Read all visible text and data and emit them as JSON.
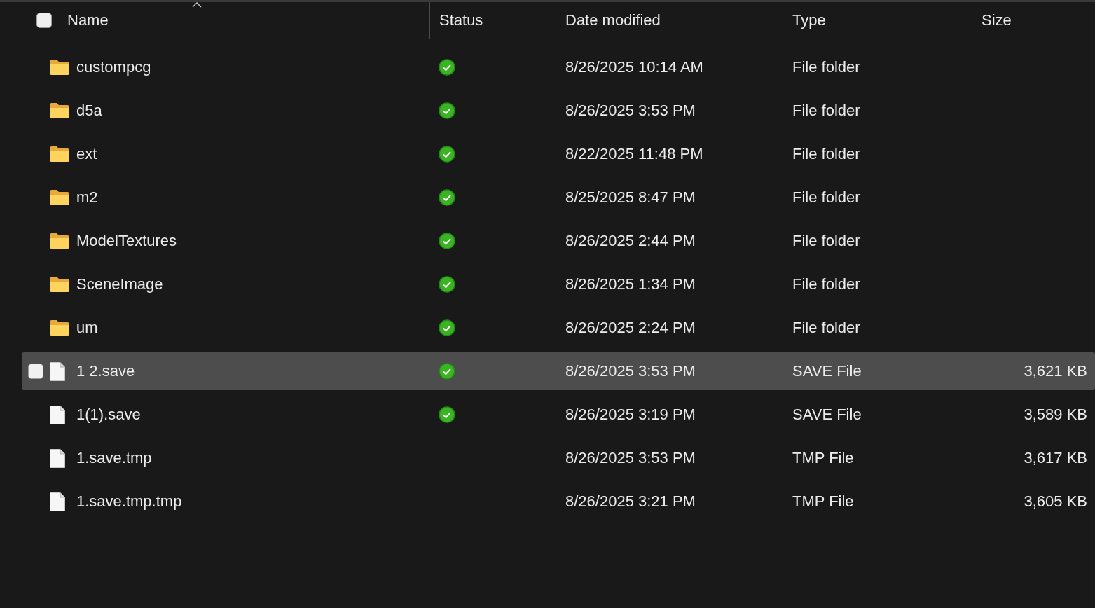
{
  "header": {
    "checkbox": {
      "checked": false
    },
    "columns": [
      {
        "label": "Name",
        "sorted": true
      },
      {
        "label": "Status",
        "sorted": false
      },
      {
        "label": "Date modified",
        "sorted": false
      },
      {
        "label": "Type",
        "sorted": false
      },
      {
        "label": "Size",
        "sorted": false
      }
    ]
  },
  "rows": [
    {
      "kind": "folder",
      "name": "custompcg",
      "synced": true,
      "date": "8/26/2025 10:14 AM",
      "type": "File folder",
      "hovered": false
    },
    {
      "kind": "folder",
      "name": "d5a",
      "synced": true,
      "date": "8/26/2025 3:53 PM",
      "type": "File folder",
      "hovered": false
    },
    {
      "kind": "folder",
      "name": "ext",
      "synced": true,
      "date": "8/22/2025 11:48 PM",
      "type": "File folder",
      "hovered": false
    },
    {
      "kind": "folder",
      "name": "m2",
      "synced": true,
      "date": "8/25/2025 8:47 PM",
      "type": "File folder",
      "hovered": false
    },
    {
      "kind": "folder",
      "name": "ModelTextures",
      "synced": true,
      "date": "8/26/2025 2:44 PM",
      "type": "File folder",
      "hovered": false
    },
    {
      "kind": "folder",
      "name": "SceneImage",
      "synced": true,
      "date": "8/26/2025 1:34 PM",
      "type": "File folder",
      "hovered": false
    },
    {
      "kind": "folder",
      "name": "um",
      "synced": true,
      "date": "8/26/2025 2:24 PM",
      "type": "File folder",
      "hovered": false
    },
    {
      "kind": "file",
      "name": "1 2.save",
      "synced": true,
      "date": "8/26/2025 3:53 PM",
      "type": "SAVE File",
      "size": "3,621 KB",
      "hovered": true,
      "checked": false
    },
    {
      "kind": "file",
      "name": "1(1).save",
      "synced": true,
      "date": "8/26/2025 3:19 PM",
      "type": "SAVE File",
      "size": "3,589 KB",
      "hovered": false
    },
    {
      "kind": "file",
      "name": "1.save.tmp",
      "synced": false,
      "date": "8/26/2025 3:53 PM",
      "type": "TMP File",
      "size": "3,617 KB",
      "hovered": false
    },
    {
      "kind": "file",
      "name": "1.save.tmp.tmp",
      "synced": false,
      "date": "8/26/2025 3:21 PM",
      "type": "TMP File",
      "size": "3,605 KB",
      "hovered": false
    }
  ]
}
